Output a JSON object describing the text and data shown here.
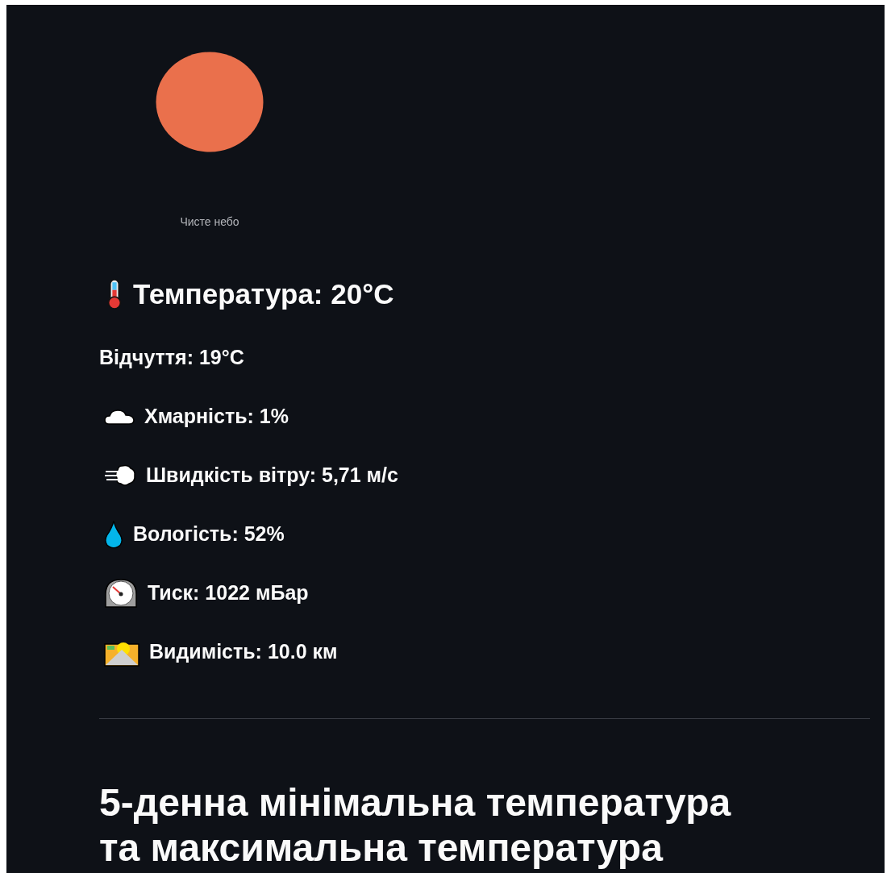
{
  "current": {
    "kind": "sun",
    "description": "Чисте небо"
  },
  "temperature": {
    "kind": "thermometer",
    "text": "Температура: 20°C"
  },
  "details": [
    {
      "kind": "plain",
      "text": "Відчуття: 19°C"
    },
    {
      "kind": "cloud",
      "text": "Хмарність: 1%"
    },
    {
      "kind": "wind",
      "text": "Швидкість вітру: 5,71 м/с"
    },
    {
      "kind": "drop",
      "text": "Вологість: 52%"
    },
    {
      "kind": "gauge",
      "text": "Тиск: 1022 мБар"
    },
    {
      "kind": "sunrise",
      "text": "Видимість: 10.0 км"
    }
  ],
  "forecast": {
    "title": "5-денна мінімальна температура та максимальна температура"
  }
}
